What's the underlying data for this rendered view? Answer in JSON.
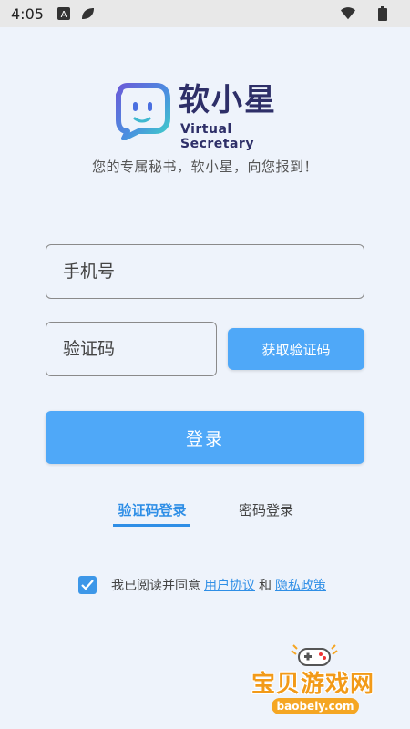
{
  "status_bar": {
    "time": "4:05",
    "icons": [
      "a-badge-icon",
      "leaf-icon",
      "wifi-icon",
      "battery-icon"
    ]
  },
  "brand": {
    "name": "软小星",
    "subtitle": "Virtual Secretary",
    "slogan": "您的专属秘书，软小星，向您报到！"
  },
  "form": {
    "phone_placeholder": "手机号",
    "code_placeholder": "验证码",
    "get_code_label": "获取验证码",
    "login_label": "登录"
  },
  "tabs": [
    {
      "label": "验证码登录",
      "active": true
    },
    {
      "label": "密码登录",
      "active": false
    }
  ],
  "agreement": {
    "checked": true,
    "prefix": "我已阅读并同意",
    "user_agreement": "用户协议",
    "and": "和",
    "privacy_policy": "隐私政策"
  },
  "watermark": {
    "text": "宝贝游戏网",
    "domain": "baobeiy.com"
  },
  "colors": {
    "accent": "#4fa8f8",
    "link": "#2e8ee6",
    "brand_text": "#2e2f68",
    "background": "#eef3fb"
  }
}
